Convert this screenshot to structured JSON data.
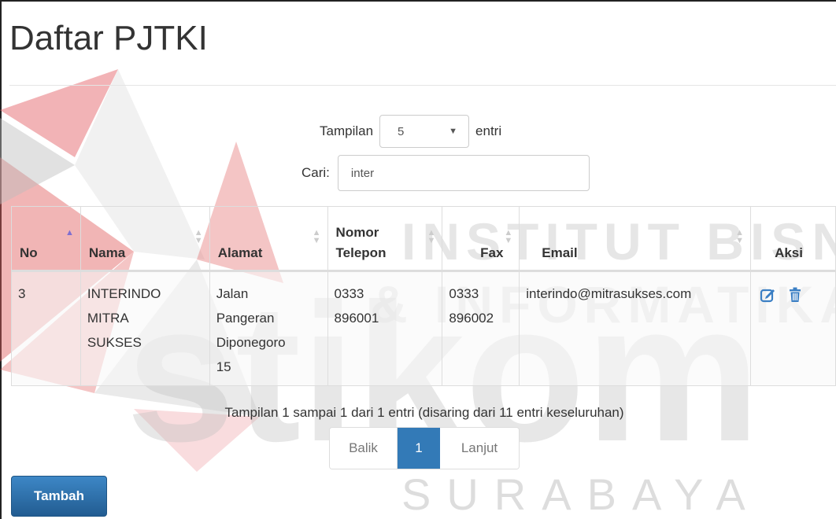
{
  "page": {
    "title": "Daftar PJTKI"
  },
  "watermark": {
    "line1": "INSTITUT BISNIS",
    "line2": "& INFORMATIKA",
    "brand": "stikom",
    "city": "SURABAYA",
    "colors": {
      "red": "#e05a5a",
      "gray": "#b5b5b5"
    }
  },
  "length_control": {
    "prefix": "Tampilan",
    "value": "5",
    "suffix": "entri"
  },
  "search": {
    "label": "Cari:",
    "value": "inter"
  },
  "table": {
    "headers": {
      "no": "No",
      "nama": "Nama",
      "alamat": "Alamat",
      "telepon_1": "Nomor",
      "telepon_2": "Telepon",
      "fax": "Fax",
      "email": "Email",
      "aksi": "Aksi"
    },
    "rows": [
      {
        "no": "3",
        "nama": [
          "INTERINDO",
          "MITRA",
          "SUKSES"
        ],
        "alamat": [
          "Jalan",
          "Pangeran",
          "Diponegoro",
          "15"
        ],
        "telepon": [
          "0333",
          "896001"
        ],
        "fax": [
          "0333",
          "896002"
        ],
        "email": "interindo@mitrasukses.com",
        "actions": {
          "edit": "edit-icon",
          "delete": "trash-icon"
        }
      }
    ]
  },
  "info": {
    "text": "Tampilan 1 sampai 1 dari 1 entri (disaring dari 11 entri keseluruhan)"
  },
  "pagination": {
    "prev": "Balik",
    "current": "1",
    "next": "Lanjut",
    "active_color": "#337ab7"
  },
  "actions": {
    "add_label": "Tambah"
  }
}
